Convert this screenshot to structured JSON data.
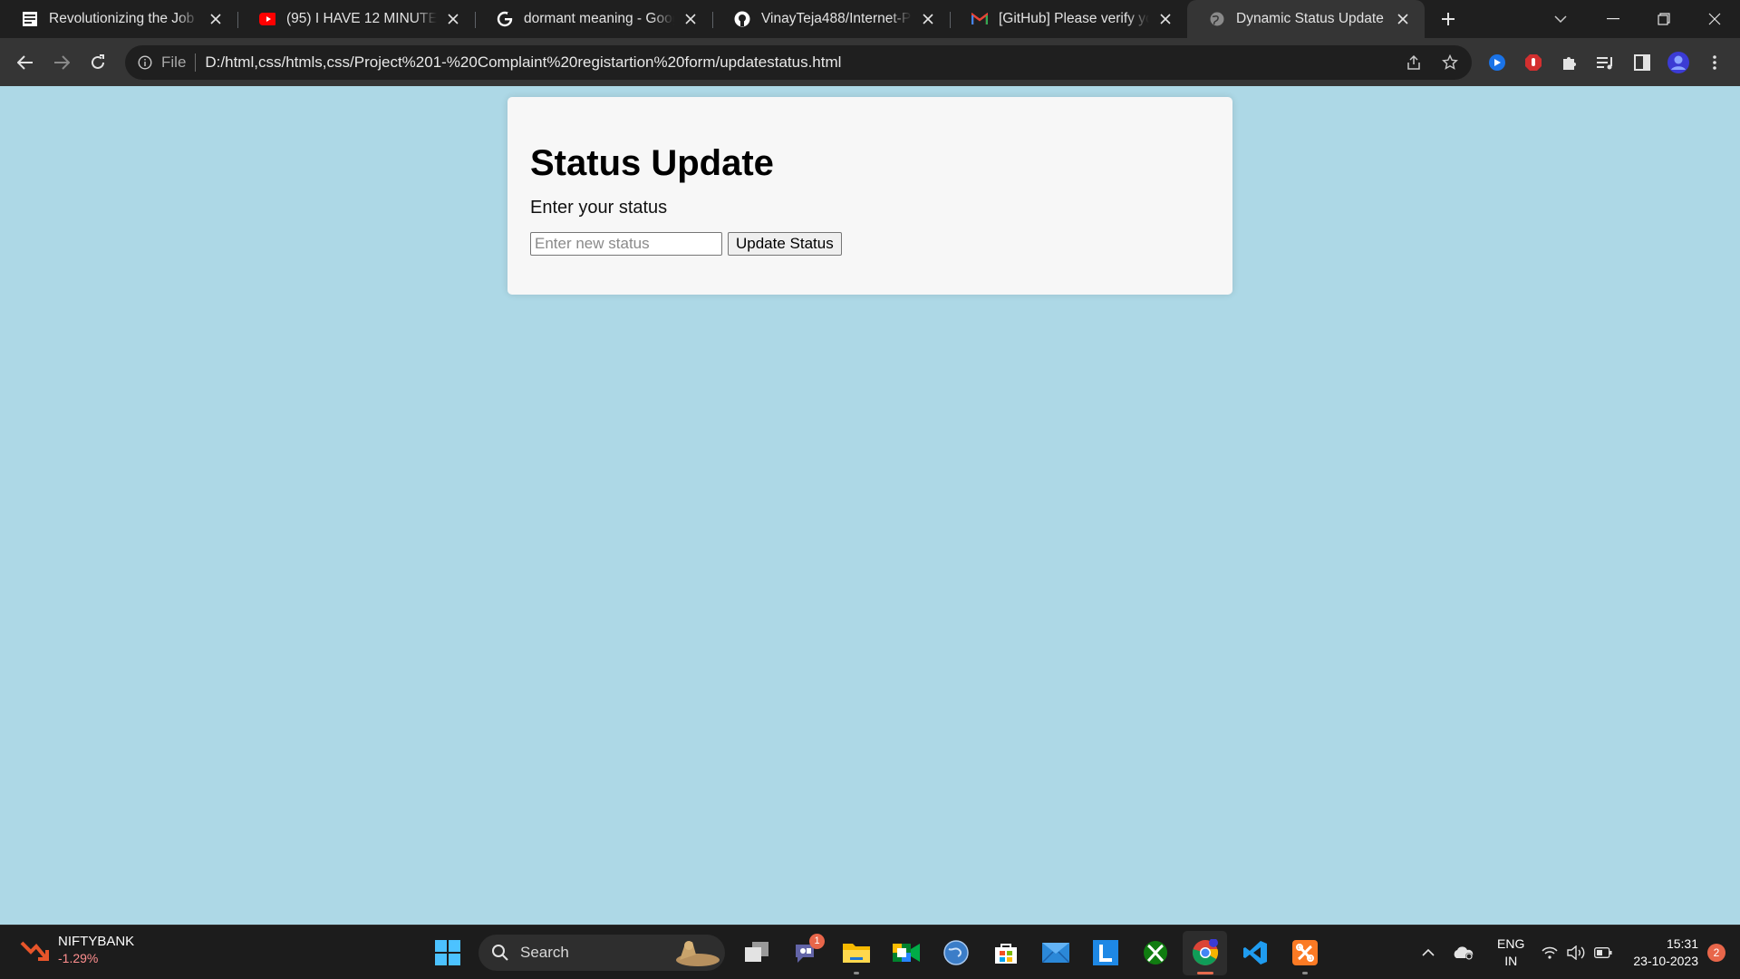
{
  "browser": {
    "tabs": [
      {
        "title": "Revolutionizing the Job Ma",
        "icon": "job-site-favicon"
      },
      {
        "title": "(95) I HAVE 12 MINUTES TO",
        "icon": "youtube-icon"
      },
      {
        "title": "dormant meaning - Google",
        "icon": "google-icon"
      },
      {
        "title": "VinayTeja488/Internet-Prog",
        "icon": "github-icon"
      },
      {
        "title": "[GitHub] Please verify your",
        "icon": "gmail-icon"
      },
      {
        "title": "Dynamic Status Update",
        "icon": "globe-icon",
        "active": true
      }
    ],
    "omnibox": {
      "scheme_label": "File",
      "url": "D:/html,css/htmls,css/Project%201-%20Complaint%20registartion%20form/updatestatus.html"
    }
  },
  "page": {
    "title": "Status Update",
    "label": "Enter your status",
    "input_placeholder": "Enter new status",
    "input_value": "",
    "button_label": "Update Status"
  },
  "taskbar": {
    "widget": {
      "name": "NIFTYBANK",
      "change": "-1.29%"
    },
    "search_label": "Search",
    "teams_badge": "1",
    "tray": {
      "lang_line1": "ENG",
      "lang_line2": "IN",
      "time": "15:31",
      "date": "23-10-2023",
      "notifications": "2"
    }
  },
  "colors": {
    "page_background": "#add8e6",
    "card_background": "#f7f7f7",
    "browser_frame": "#1f1f1f",
    "toolbar": "#353535",
    "widget_change": "#ff8f8f",
    "badge": "#e8664a"
  }
}
